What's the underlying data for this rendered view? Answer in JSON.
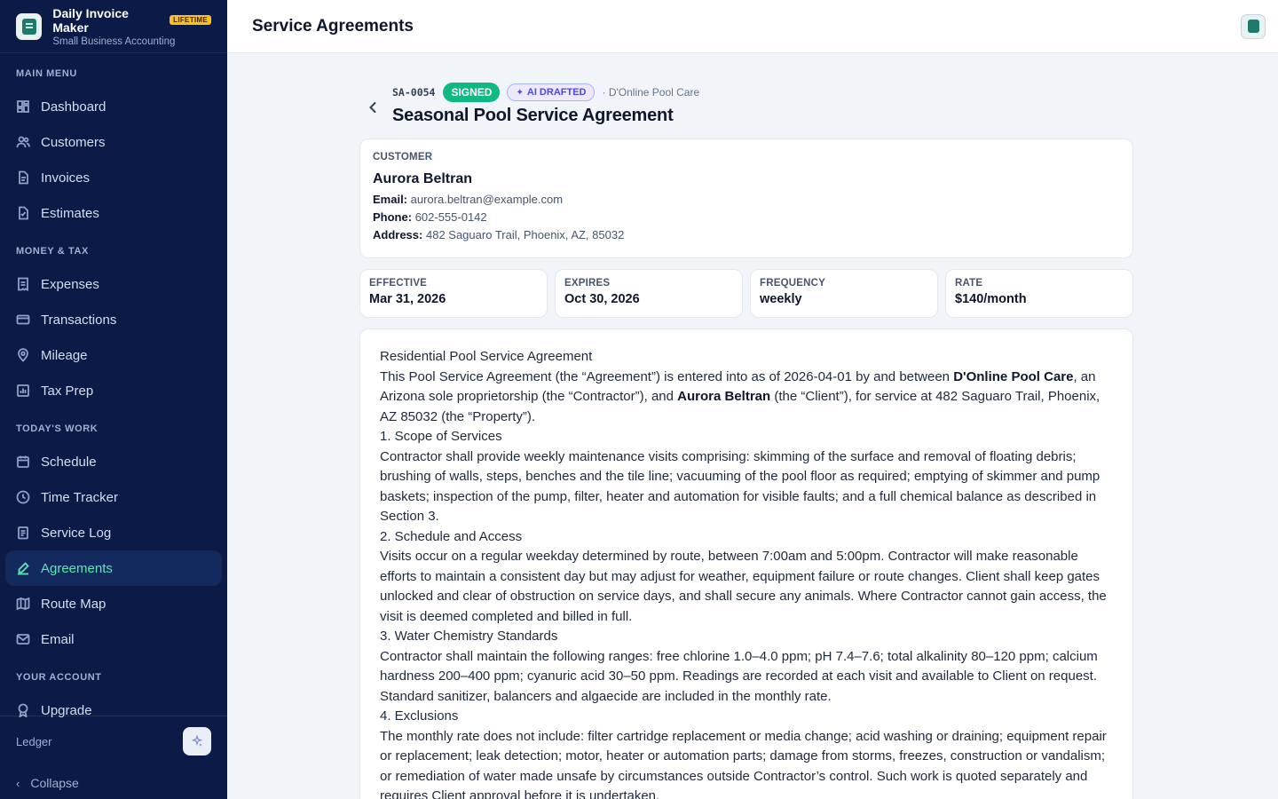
{
  "brand": {
    "name": "Daily Invoice Maker",
    "badge": "LIFETIME",
    "subtitle": "Small Business Accounting"
  },
  "sidebar": {
    "sections": {
      "main": "MAIN MENU",
      "money": "MONEY & TAX",
      "today": "TODAY'S WORK",
      "account": "YOUR ACCOUNT"
    },
    "items": {
      "dashboard": "Dashboard",
      "customers": "Customers",
      "invoices": "Invoices",
      "estimates": "Estimates",
      "expenses": "Expenses",
      "transactions": "Transactions",
      "mileage": "Mileage",
      "taxprep": "Tax Prep",
      "schedule": "Schedule",
      "timetracker": "Time Tracker",
      "servicelog": "Service Log",
      "agreements": "Agreements",
      "routemap": "Route Map",
      "email": "Email",
      "upgrade": "Upgrade"
    },
    "active": "agreements",
    "ledger_label": "Ledger",
    "collapse_label": "Collapse"
  },
  "topbar": {
    "title": "Service Agreements"
  },
  "agreement": {
    "id": "SA-0054",
    "status": "SIGNED",
    "ai_badge": "AI DRAFTED",
    "company_line": "· D'Online Pool Care",
    "title": "Seasonal Pool Service Agreement"
  },
  "customer": {
    "label": "CUSTOMER",
    "name": "Aurora Beltran",
    "email_label": "Email:",
    "email": "aurora.beltran@example.com",
    "phone_label": "Phone:",
    "phone": "602-555-0142",
    "address_label": "Address:",
    "address": "482 Saguaro Trail, Phoenix, AZ, 85032"
  },
  "stats": {
    "effective_label": "EFFECTIVE",
    "effective": "Mar 31, 2026",
    "expires_label": "EXPIRES",
    "expires": "Oct 30, 2026",
    "frequency_label": "FREQUENCY",
    "frequency": "weekly",
    "rate_label": "RATE",
    "rate": "$140/month"
  },
  "document": {
    "heading": "Residential Pool Service Agreement",
    "intro_a": "This Pool Service Agreement (the “Agreement”) is entered into as of 2026-04-01 by and between ",
    "intro_company": "D'Online Pool Care",
    "intro_b": ", an Arizona sole proprietorship (the “Contractor”), and ",
    "intro_client": "Aurora Beltran",
    "intro_c": " (the “Client”), for service at 482 Saguaro Trail, Phoenix, AZ 85032 (the “Property”).",
    "s1_title": "1. Scope of Services",
    "s1_body": "Contractor shall provide weekly maintenance visits comprising: skimming of the surface and removal of floating debris; brushing of walls, steps, benches and the tile line; vacuuming of the pool floor as required; emptying of skimmer and pump baskets; inspection of the pump, filter, heater and automation for visible faults; and a full chemical balance as described in Section 3.",
    "s2_title": "2. Schedule and Access",
    "s2_body": "Visits occur on a regular weekday determined by route, between 7:00am and 5:00pm. Contractor will make reasonable efforts to maintain a consistent day but may adjust for weather, equipment failure or route changes. Client shall keep gates unlocked and clear of obstruction on service days, and shall secure any animals. Where Contractor cannot gain access, the visit is deemed completed and billed in full.",
    "s3_title": "3. Water Chemistry Standards",
    "s3_body": "Contractor shall maintain the following ranges: free chlorine 1.0–4.0 ppm; pH 7.4–7.6; total alkalinity 80–120 ppm; calcium hardness 200–400 ppm; cyanuric acid 30–50 ppm. Readings are recorded at each visit and available to Client on request. Standard sanitizer, balancers and algaecide are included in the monthly rate.",
    "s4_title": "4. Exclusions",
    "s4_body": "The monthly rate does not include: filter cartridge replacement or media change; acid washing or draining; equipment repair or replacement; leak detection; motor, heater or automation parts; damage from storms, freezes, construction or vandalism; or remediation of water made unsafe by circumstances outside Contractor’s control. Such work is quoted separately and requires Client approval before it is undertaken."
  }
}
